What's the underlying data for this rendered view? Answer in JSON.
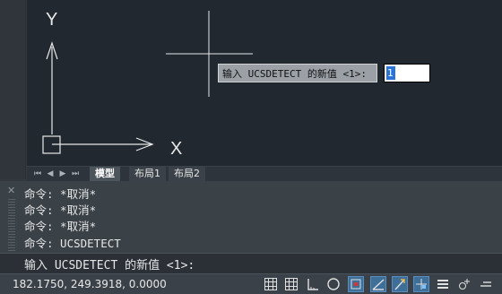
{
  "canvas": {
    "ucs_y_label": "Y",
    "ucs_x_label": "X",
    "dynamic_prompt": "输入 UCSDETECT 的新值 <1>:",
    "dynamic_input_value": "1"
  },
  "tabs": {
    "items": [
      {
        "label": "模型",
        "active": true
      },
      {
        "label": "布局1",
        "active": false
      },
      {
        "label": "布局2",
        "active": false
      }
    ]
  },
  "command": {
    "close_label": "✕",
    "history": [
      "命令: *取消*",
      "命令: *取消*",
      "命令: *取消*",
      "命令: UCSDETECT"
    ],
    "input_prompt": "输入 UCSDETECT 的新值 <1>:"
  },
  "status": {
    "coordinates": "182.1750, 249.3918, 0.0000",
    "buttons": [
      {
        "icon": "model-grid-icon",
        "active": false
      },
      {
        "icon": "grid-display-icon",
        "active": false
      },
      {
        "icon": "snap-mode-icon",
        "active": false
      },
      {
        "icon": "ortho-mode-icon",
        "active": false
      },
      {
        "icon": "polar-tracking-icon",
        "active": true
      },
      {
        "icon": "isometric-drafting-icon",
        "active": false
      },
      {
        "icon": "object-snap-tracking-icon",
        "active": false
      },
      {
        "icon": "object-snap-icon",
        "active": false
      },
      {
        "icon": "lineweight-icon",
        "active": false
      },
      {
        "icon": "annotation-scale-icon",
        "active": false
      },
      {
        "icon": "selection-cycling-icon",
        "active": false
      }
    ]
  },
  "colors": {
    "canvas_bg": "#212830",
    "selection_blue": "#2a74d6",
    "active_button": "#3e6f99"
  }
}
